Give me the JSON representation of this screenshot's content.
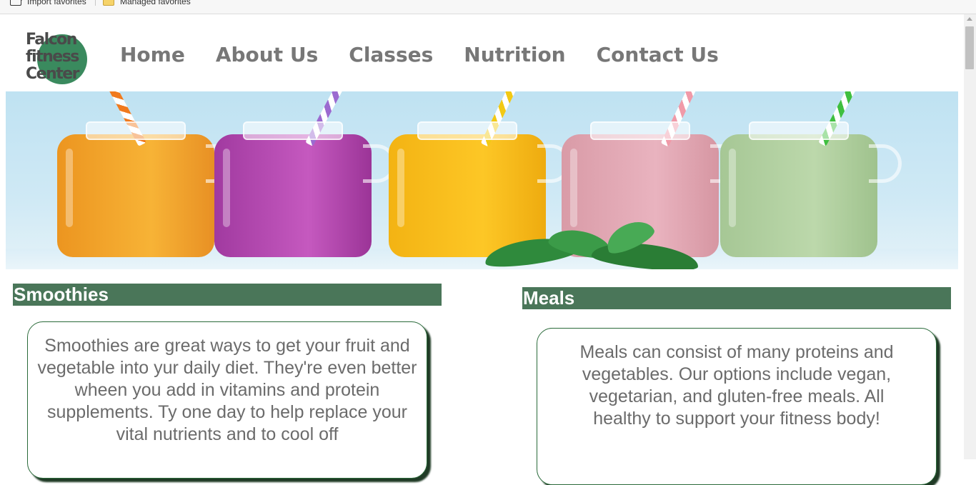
{
  "favorites_bar": {
    "items": [
      {
        "label": "Import favorites",
        "icon": "import-icon"
      },
      {
        "label": "Managed favorites",
        "icon": "folder-icon"
      }
    ]
  },
  "site": {
    "logo": {
      "line1": "Falcon",
      "line2": "fitness",
      "line3": "Center"
    },
    "nav": [
      "Home",
      "About Us",
      "Classes",
      "Nutrition",
      "Contact Us"
    ]
  },
  "hero": {
    "image": "five-smoothie-jars-banner"
  },
  "sections": {
    "smoothies": {
      "title": "Smoothies",
      "body": "Smoothies are great ways to get your fruit and vegetable into yur daily diet. They're even better wheen you add in vitamins and protein supplements. Ty one day to help replace your vital nutrients and to cool off"
    },
    "meals": {
      "title": "Meals",
      "body": "Meals can consist of many proteins and vegetables. Our options include vegan, vegetarian, and gluten-free meals. All healthy to support your fitness body!"
    }
  },
  "colors": {
    "section_header_bg": "#4a7659",
    "logo_circle": "#3a8a5e",
    "nav_text": "#777777",
    "body_text": "#6b6b6b"
  }
}
